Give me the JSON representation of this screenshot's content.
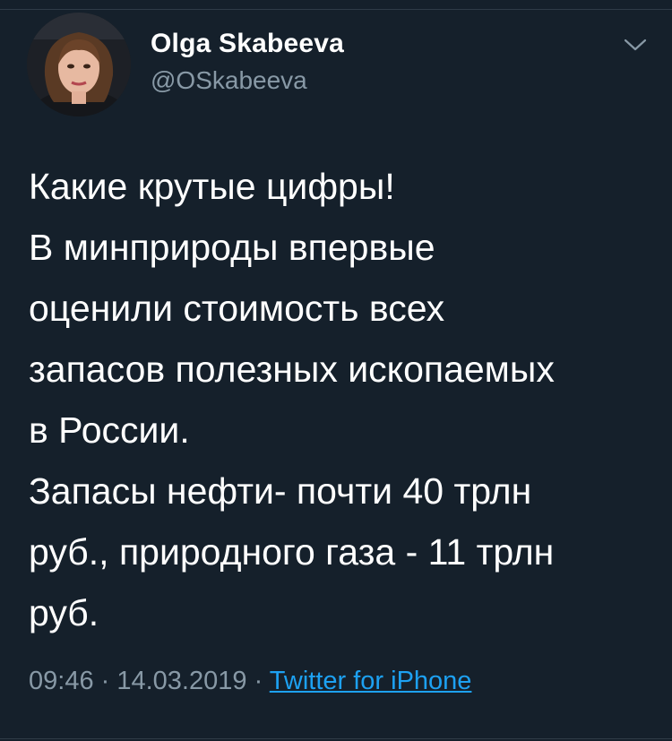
{
  "author": {
    "name": "Olga Skabeeva",
    "handle": "@OSkabeeva"
  },
  "tweet": {
    "lines": [
      "Какие крутые цифры!",
      "В минприроды впервые",
      "оценили стоимость всех",
      "запасов полезных ископаемых",
      "в России.",
      "Запасы нефти- почти 40 трлн",
      "руб., природного газа - 11 трлн",
      "руб."
    ]
  },
  "meta": {
    "time": "09:46",
    "separator": " · ",
    "date": "14.03.2019",
    "source": "Twitter for iPhone"
  },
  "icons": {
    "menu": "chevron-down-icon"
  },
  "colors": {
    "background": "#15202b",
    "text": "#ffffff",
    "secondary": "#8899a6",
    "link": "#1da1f2"
  }
}
